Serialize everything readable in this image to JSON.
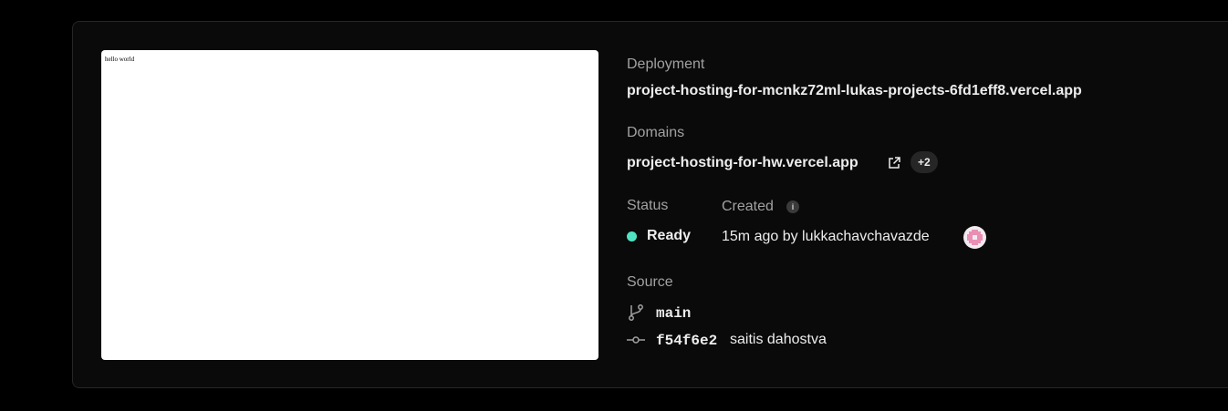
{
  "preview": {
    "text": "hello world"
  },
  "deployment": {
    "label": "Deployment",
    "url": "project-hosting-for-mcnkz72ml-lukas-projects-6fd1eff8.vercel.app"
  },
  "domains": {
    "label": "Domains",
    "primary": "project-hosting-for-hw.vercel.app",
    "extra_count": "+2"
  },
  "status": {
    "label": "Status",
    "value": "Ready",
    "color": "#50e3c2"
  },
  "created": {
    "label": "Created",
    "value": "15m ago by lukkachavchavazde",
    "info_icon": "i"
  },
  "source": {
    "label": "Source",
    "branch": "main",
    "commit_hash": "f54f6e2",
    "commit_message": "saitis dahostva"
  }
}
